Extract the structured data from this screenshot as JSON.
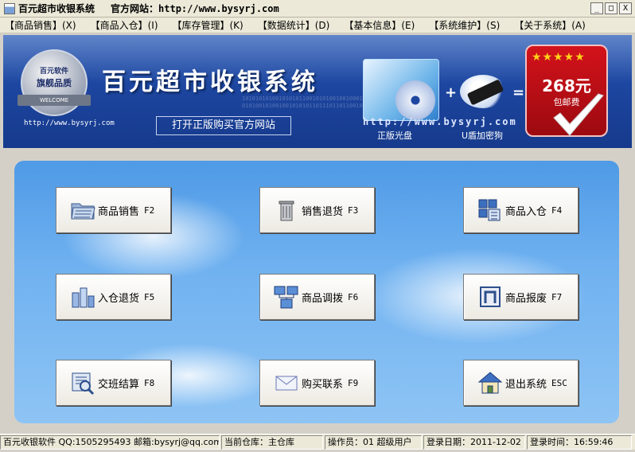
{
  "window": {
    "title": "百元超市收银系统",
    "site_label": "官方网站：http://www.bysyrj.com",
    "controls": {
      "minimize": "_",
      "maximize": "□",
      "close": "X"
    }
  },
  "menu": [
    {
      "label": "【商品销售】(X)"
    },
    {
      "label": "【商品入仓】(I)"
    },
    {
      "label": "【库存管理】(K)"
    },
    {
      "label": "【数据统计】(D)"
    },
    {
      "label": "【基本信息】(E)"
    },
    {
      "label": "【系统维护】(S)"
    },
    {
      "label": "【关于系统】(A)"
    }
  ],
  "banner": {
    "badge_line1": "百元软件",
    "badge_line2": "旗舰品质",
    "badge_ribbon": "WELCOME",
    "url": "http://www.bysyrj.com",
    "title": "百元超市收银系统",
    "binary_line1": "10101010100101010110010101001001000111001010110010",
    "binary_line2": "0101001010010010101011011101101100101101001",
    "buy_link": "打开正版购买官方网站",
    "site_text": "http://www.bysyrj.com",
    "caption_cd": "正版光盘",
    "caption_usb": "U盾加密狗",
    "stars": "★★★★★",
    "price": "268元",
    "shipping": "包邮费",
    "plus": "+",
    "equals": "="
  },
  "functions": [
    {
      "label": "商品销售",
      "key": "F2",
      "icon": "folder-icon"
    },
    {
      "label": "销售退货",
      "key": "F3",
      "icon": "trash-icon"
    },
    {
      "label": "商品入仓",
      "key": "F4",
      "icon": "warehouse-icon"
    },
    {
      "label": "入仓退货",
      "key": "F5",
      "icon": "return-icon"
    },
    {
      "label": "商品调拨",
      "key": "F6",
      "icon": "network-icon"
    },
    {
      "label": "商品报废",
      "key": "F7",
      "icon": "scrap-icon"
    },
    {
      "label": "交班结算",
      "key": "F8",
      "icon": "settle-icon"
    },
    {
      "label": "购买联系",
      "key": "F9",
      "icon": "mail-icon"
    },
    {
      "label": "退出系统",
      "key": "ESC",
      "icon": "home-icon"
    }
  ],
  "status": {
    "company": "百元收银软件 QQ:1505295493 邮箱:bysyrj@qq.com",
    "warehouse": "当前仓库：主仓库",
    "operator": "操作员：01 超级用户",
    "login_date": "登录日期：2011-12-02",
    "login_time": "登录时间：16:59:46"
  },
  "colors": {
    "banner_blue": "#1d46a0",
    "panel_blue": "#6fb1f0",
    "price_red": "#d4121b",
    "chrome": "#ece9d8"
  }
}
